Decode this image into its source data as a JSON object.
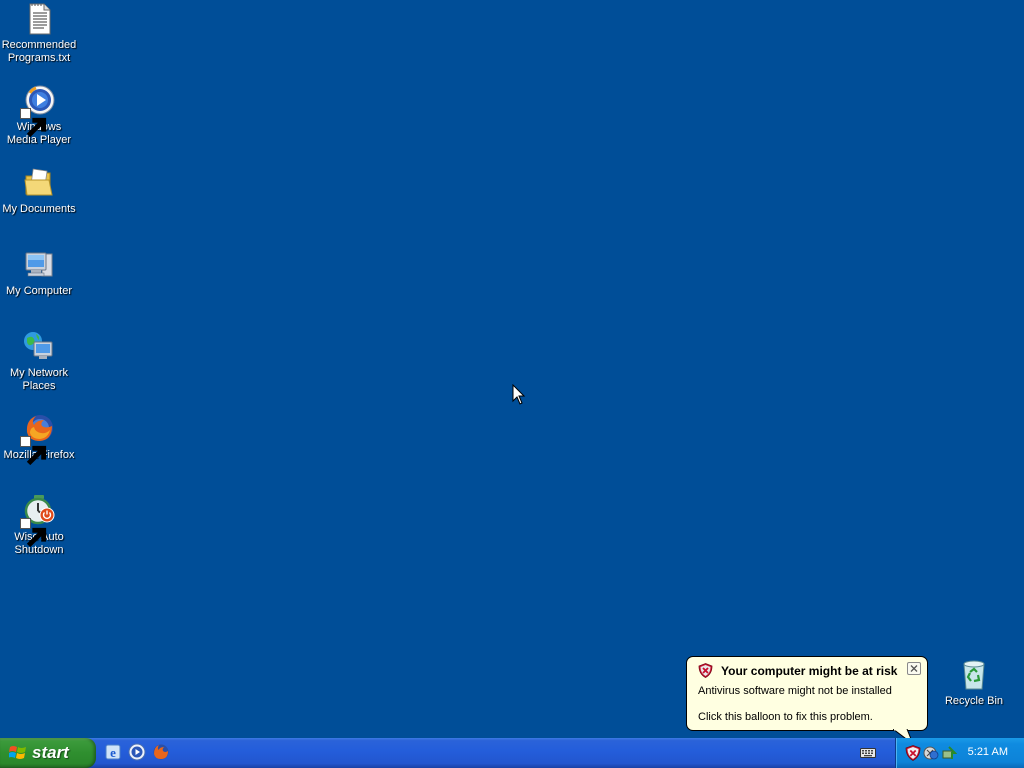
{
  "desktop": {
    "background_color": "#004e98",
    "icons": [
      {
        "label": "Recommended Programs.txt",
        "icon": "text-file-icon"
      },
      {
        "label": "Windows Media Player",
        "icon": "media-player-icon"
      },
      {
        "label": "My Documents",
        "icon": "folder-icon"
      },
      {
        "label": "My Computer",
        "icon": "computer-icon"
      },
      {
        "label": "My Network Places",
        "icon": "network-places-icon"
      },
      {
        "label": "Mozilla Firefox",
        "icon": "firefox-icon"
      },
      {
        "label": "Wise Auto Shutdown",
        "icon": "shutdown-icon"
      },
      {
        "label": "Recycle Bin",
        "icon": "recycle-bin-icon"
      }
    ]
  },
  "taskbar": {
    "start_label": "start",
    "quick_launch": [
      "internet-explorer-icon",
      "media-player-icon",
      "firefox-icon"
    ],
    "tray_icons": [
      "security-alert-icon",
      "network-icon",
      "safely-remove-icon"
    ],
    "clock": "5:21 AM"
  },
  "balloon": {
    "title": "Your computer might be at risk",
    "message": "Antivirus software might not be installed",
    "action": "Click this balloon to fix this problem."
  },
  "colors": {
    "taskbar_blue": "#245edb",
    "start_green": "#2f8f2f",
    "tray_blue": "#0f8be0",
    "balloon_bg": "#ffffe1",
    "alert_red": "#c8102e"
  }
}
